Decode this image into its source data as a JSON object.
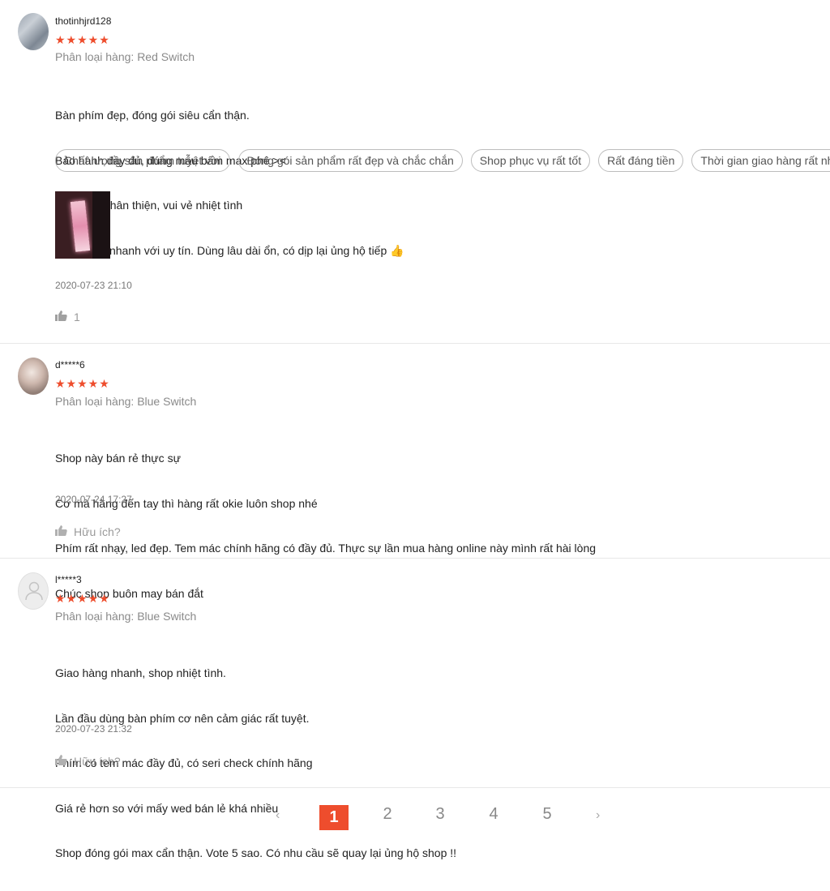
{
  "reviews": [
    {
      "username": "thotinhjrd128",
      "stars": "★★★★★",
      "variant": "Phân loại hàng: Red Switch",
      "comment": [
        "Bàn phím đẹp, đóng gói siêu cẩn thận.",
        "Bảo hành đầy đủ, đúng mẫu bấm max phê ><",
        "Chủ shop thân thiện, vui vẻ nhiệt tình",
        "Shop giao nhanh với uy tín. Dùng lâu dài ổn, có dịp lại ủng hộ tiếp 👍"
      ],
      "tags": [
        "Chất lượng sản phẩm tuyệt vời",
        "Đóng gói sản phẩm rất đẹp và chắc chắn",
        "Shop phục vụ rất tốt",
        "Rất đáng tiền",
        "Thời gian giao hàng rất nhanh"
      ],
      "timestamp": "2020-07-23 21:10",
      "like_label": "1",
      "icons": {
        "like": "thumbs-up-icon",
        "avatar": "user-photo"
      }
    },
    {
      "username": "d*****6",
      "stars": "★★★★★",
      "variant": "Phân loại hàng: Blue Switch",
      "comment": [
        "Shop này bán rẻ thực sự",
        "Cơ mà hàng đến tay thì hàng rất okie luôn shop nhé",
        "Phím rất nhạy, led đẹp. Tem mác chính hãng có đầy đủ. Thực sự lần mua hàng online này mình rất hài lòng",
        "Chúc shop buôn may bán đắt"
      ],
      "timestamp": "2020-07-24 17:27",
      "like_label": "Hữu ích?"
    },
    {
      "username": "l*****3",
      "stars": "★★★★★",
      "variant": "Phân loại hàng: Blue Switch",
      "comment": [
        "Giao hàng nhanh, shop nhiệt tình.",
        "Lần đầu dùng bàn phím cơ nên cảm giác rất tuyệt.",
        "Phím có tem mác đầy đủ, có seri check chính hãng",
        "Giá rẻ hơn so với mấy wed bán lẻ khá nhiều",
        "Shop đóng gói max cẩn thận. Vote 5 sao. Có nhu cầu sẽ quay lại ủng hộ shop !!"
      ],
      "timestamp": "2020-07-23 21:32",
      "like_label": "Hữu ích?"
    }
  ],
  "pagination": {
    "prev": "‹",
    "pages": [
      "1",
      "2",
      "3",
      "4",
      "5"
    ],
    "active_page": "1",
    "next": "›"
  }
}
